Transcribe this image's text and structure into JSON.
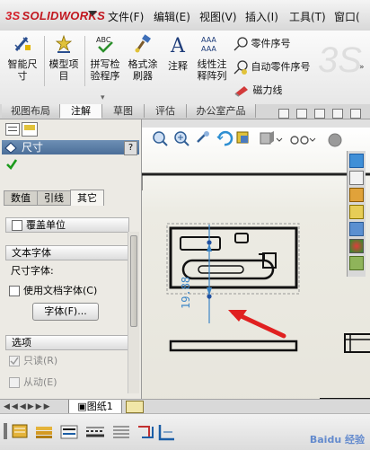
{
  "app": {
    "brand": "SOLIDWORKS"
  },
  "menu": [
    "文件(F)",
    "编辑(E)",
    "视图(V)",
    "插入(I)",
    "工具(T)",
    "窗口("
  ],
  "ribbon": {
    "smart_dim_1": "智能尺",
    "smart_dim_2": "寸",
    "model_items_1": "模型项",
    "model_items_2": "目",
    "spell_1": "拼写检",
    "spell_2": "验程序",
    "format_1": "格式涂",
    "format_2": "刷器",
    "note": "注释",
    "linear_note_1": "线性注",
    "linear_note_2": "释阵列",
    "spell_icon_text": "ABC",
    "note_icon_text": "A",
    "linear_icon_text": "AAA",
    "balloon": "零件序号",
    "auto_balloon": "自动零件序号",
    "magnetic_line": "磁力线"
  },
  "tabs": [
    "视图布局",
    "注解",
    "草图",
    "评估",
    "办公室产品"
  ],
  "active_tab": "注解",
  "property_manager": {
    "title": "尺寸",
    "help": "?",
    "subtabs": [
      "数值",
      "引线",
      "其它"
    ],
    "active_subtab": "其它",
    "override_units": "覆盖单位",
    "text_font_group": "文本字体",
    "dim_font_label": "尺寸字体:",
    "use_doc_font": "使用文档字体(C)",
    "font_button": "字体(F)...",
    "options_group": "选项",
    "read_only": "只读(R)",
    "driven": "从动(E)"
  },
  "drawing": {
    "dimension_text": "19.88"
  },
  "sheet_tab": "图纸1",
  "watermark": "Baidu 经验",
  "colors": {
    "accent": "#4b6e98",
    "arrow": "#e02020",
    "dimension": "#3d86c6"
  }
}
